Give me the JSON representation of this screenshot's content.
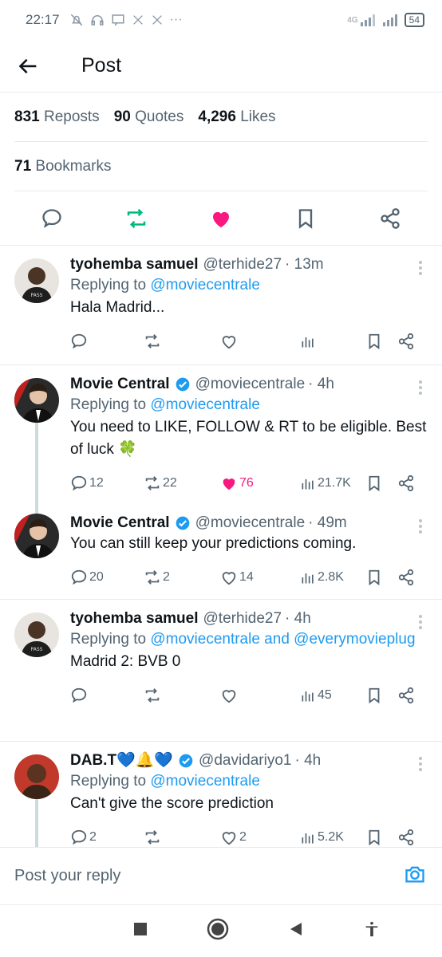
{
  "status_bar": {
    "time": "22:17",
    "network": "4G",
    "battery": "54"
  },
  "header": {
    "title": "Post"
  },
  "stats": {
    "reposts_count": "831",
    "reposts_label": "Reposts",
    "quotes_count": "90",
    "quotes_label": "Quotes",
    "likes_count": "4,296",
    "likes_label": "Likes",
    "bookmarks_count": "71",
    "bookmarks_label": "Bookmarks"
  },
  "colors": {
    "accent": "#1d9bf0",
    "repost_green": "#00ba7c",
    "like_pink": "#f91880",
    "muted": "#536471"
  },
  "replies": [
    {
      "name": "tyohemba samuel",
      "handle": "@terhide27",
      "time": "· 13m",
      "reply_prefix": "Replying to",
      "reply_to": "@moviecentrale",
      "text": "Hala Madrid...",
      "comments": "",
      "reposts": "",
      "likes": "",
      "views": ""
    },
    {
      "name": "Movie Central",
      "handle": "@moviecentrale",
      "time": "· 4h",
      "reply_prefix": "Replying to",
      "reply_to": "@moviecentrale",
      "text": "You need to LIKE, FOLLOW & RT to be eligible. Best of luck 🍀",
      "comments": "12",
      "reposts": "22",
      "likes": "76",
      "views": "21.7K"
    },
    {
      "name": "Movie Central",
      "handle": "@moviecentrale",
      "time": "· 49m",
      "text": "You can still keep your predictions coming.",
      "comments": "20",
      "reposts": "2",
      "likes": "14",
      "views": "2.8K"
    },
    {
      "name": "tyohemba samuel",
      "handle": "@terhide27",
      "time": "· 4h",
      "reply_prefix": "Replying to",
      "reply_to": "@moviecentrale and @everymovieplug",
      "text": "Madrid 2: BVB 0",
      "comments": "",
      "reposts": "",
      "likes": "",
      "views": "45"
    },
    {
      "name": "DAB.T💙🔔💙",
      "handle": "@davidariyo1",
      "time": "· 4h",
      "reply_prefix": "Replying to",
      "reply_to": "@moviecentrale",
      "text": "Can't give the score prediction",
      "comments": "2",
      "reposts": "",
      "likes": "2",
      "views": "5.2K"
    }
  ],
  "reply_input": {
    "placeholder": "Post your reply"
  }
}
